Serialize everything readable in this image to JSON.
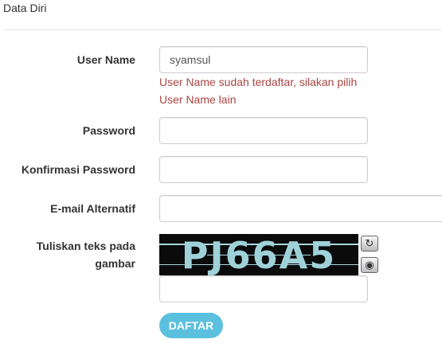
{
  "section": {
    "title": "Data Diri"
  },
  "form": {
    "username": {
      "label": "User Name",
      "value": "syamsul",
      "error_line1": "User Name sudah terdaftar, silakan pilih",
      "error_line2": "User Name lain"
    },
    "password": {
      "label": "Password",
      "value": ""
    },
    "confirm_password": {
      "label": "Konfirmasi Password",
      "value": ""
    },
    "alt_email": {
      "label": "E-mail Alternatif",
      "value": ""
    },
    "captcha": {
      "label_line1": "Tuliskan teks pada",
      "label_line2": "gambar",
      "image_text": "PJ66A5",
      "refresh_icon": "refresh-icon",
      "audio_icon": "audio-icon",
      "value": ""
    },
    "submit_label": "DAFTAR"
  },
  "colors": {
    "error": "#a94442",
    "submit_bg": "#5bc0de",
    "captcha_bg": "#0b0b0b",
    "captcha_text": "#9fd2d8"
  }
}
